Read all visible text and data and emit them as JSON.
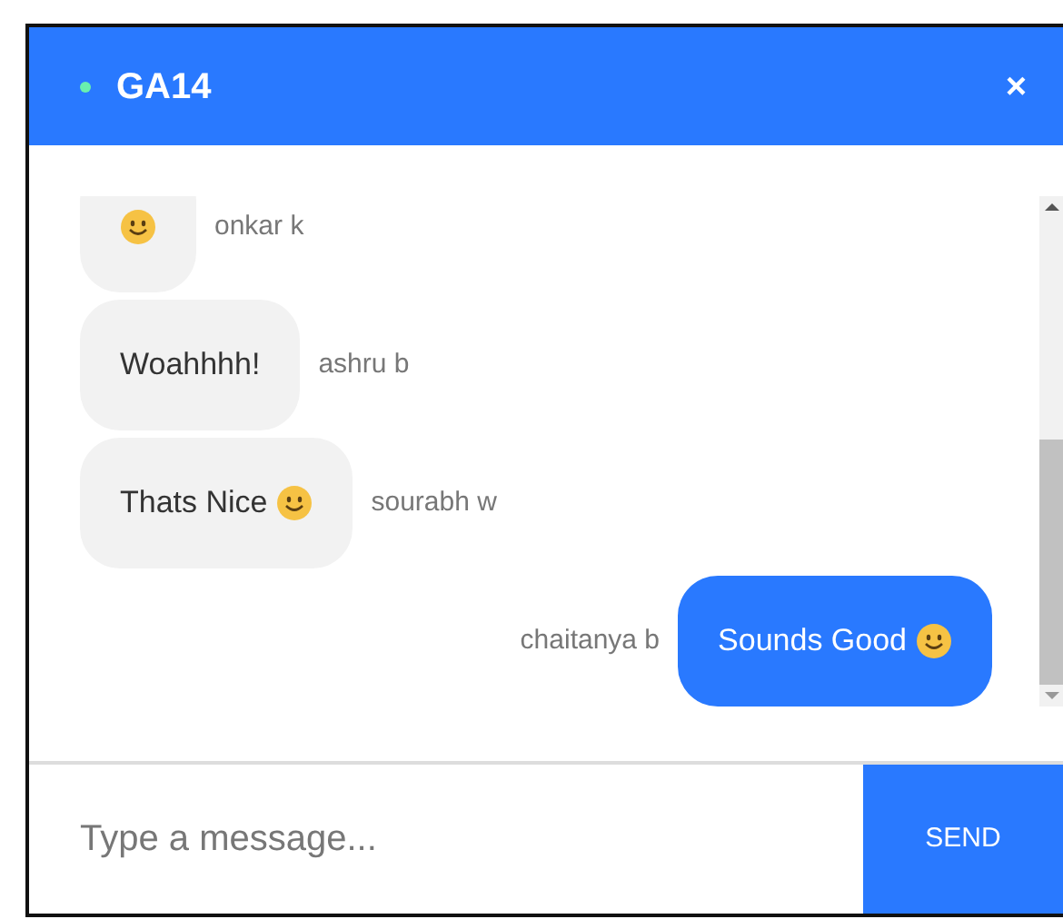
{
  "header": {
    "online": true,
    "title": "GA14",
    "close": "×"
  },
  "messages": [
    {
      "kind": "incoming",
      "emoji": true,
      "author": "onkar k"
    },
    {
      "kind": "incoming",
      "text": "Woahhhh!",
      "emoji": false,
      "author": "ashru b"
    },
    {
      "kind": "incoming",
      "text": "Thats Nice",
      "emoji": true,
      "author": "sourabh w"
    },
    {
      "kind": "outgoing",
      "text": "Sounds Good",
      "emoji": true,
      "author": "chaitanya b"
    }
  ],
  "composer": {
    "placeholder": "Type a message...",
    "send": "SEND"
  }
}
